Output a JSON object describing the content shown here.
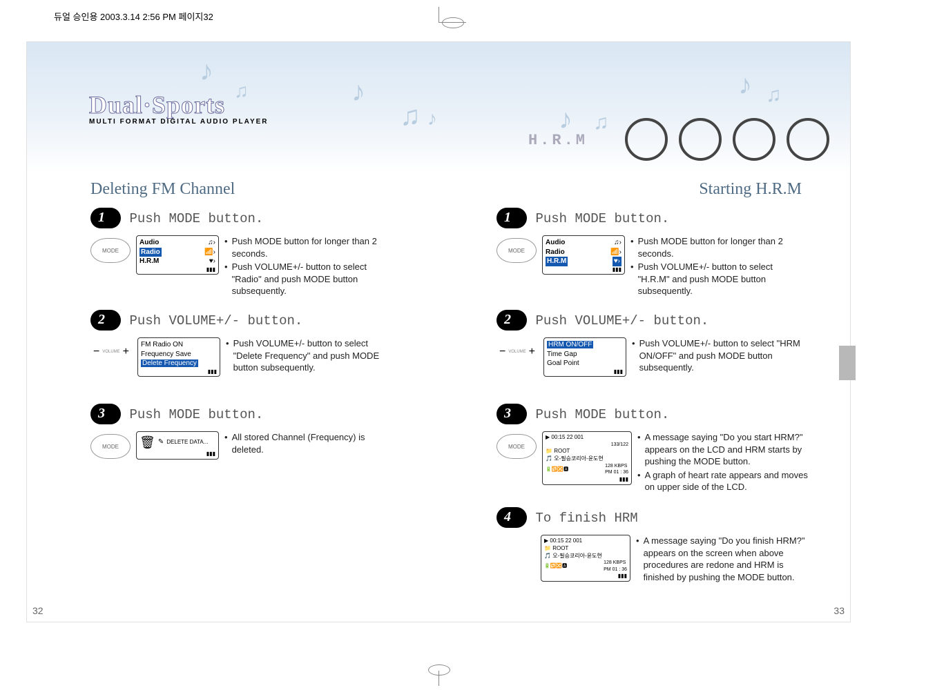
{
  "print_header": "듀얼 승인용  2003.3.14 2:56 PM  페이지32",
  "logo": {
    "title": "Dual·Sports",
    "subtitle": "MULTI FORMAT DIGITAL AUDIO PLAYER"
  },
  "banner": {
    "hrm_label": "H.R.M"
  },
  "left": {
    "title": "Deleting FM Channel",
    "step1": {
      "heading": "Push MODE button.",
      "mode_btn": "MODE",
      "lcd": {
        "audio": "Audio",
        "radio": "Radio",
        "hrm": "H.R.M"
      },
      "bullet1": "Push MODE button for longer than 2 seconds.",
      "bullet2": "Push VOLUME+/- button to select \"Radio\" and push MODE button subsequently."
    },
    "step2": {
      "heading": "Push VOLUME+/- button.",
      "vol_label": "VOLUME",
      "lcd": {
        "l1": "FM Radio ON",
        "l2": "Frequency Save",
        "l3": "Delete Frequency"
      },
      "bullet1": "Push VOLUME+/- button to select \"Delete Frequency\" and push MODE button subsequently."
    },
    "step3": {
      "heading": "Push MODE button.",
      "mode_btn": "MODE",
      "lcd_text": "DELETE DATA...",
      "bullet1": "All stored Channel (Frequency) is deleted."
    }
  },
  "right": {
    "title": "Starting H.R.M",
    "step1": {
      "heading": "Push MODE button.",
      "mode_btn": "MODE",
      "lcd": {
        "audio": "Audio",
        "radio": "Radio",
        "hrm": "H.R.M"
      },
      "bullet1": "Push MODE button for longer than 2 seconds.",
      "bullet2": "Push VOLUME+/- button to select \"H.R.M\" and push MODE button subsequently."
    },
    "step2": {
      "heading": "Push VOLUME+/- button.",
      "vol_label": "VOLUME",
      "lcd": {
        "l1": "HRM ON/OFF",
        "l2": "Time Gap",
        "l3": "Goal Point"
      },
      "bullet1": "Push VOLUME+/- button to select \"HRM ON/OFF\" and push MODE button subsequently."
    },
    "step3": {
      "heading": "Push MODE button.",
      "mode_btn": "MODE",
      "lcd": {
        "top": "▶ 00:15  22  001",
        "ratio": "133/122",
        "root": "ROOT",
        "track": "오-필승코리아-윤도현",
        "kbps": "128 KBPS",
        "time": "PM 01 : 36"
      },
      "bullet1": "A message saying \"Do you start HRM?\" appears on the LCD and HRM starts by pushing the MODE button.",
      "bullet2": "A graph of heart rate appears and moves on upper side of the LCD."
    },
    "step4": {
      "heading": "To finish HRM",
      "lcd": {
        "top": "▶ 00:15  22  001",
        "root": "ROOT",
        "track": "오-필승코리아-윤도현",
        "kbps": "128 KBPS",
        "time": "PM 01 : 36"
      },
      "bullet1": "A message saying \"Do you finish HRM?\" appears on the screen when above procedures are redone and HRM is finished by pushing the MODE button."
    }
  },
  "page_left": "32",
  "page_right": "33"
}
